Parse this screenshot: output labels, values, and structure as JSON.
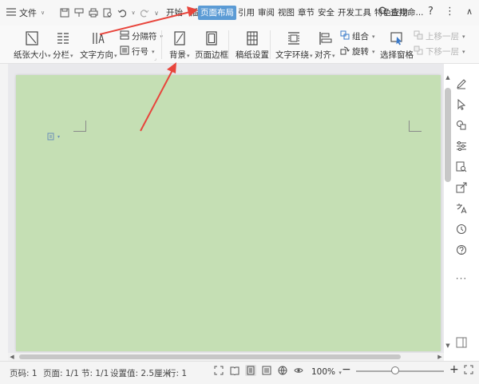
{
  "menubar": {
    "file_label": "文件",
    "tabs": [
      {
        "label": "开始",
        "active": false
      },
      {
        "label": "插入",
        "active": false
      },
      {
        "label": "页面布局",
        "active": true
      },
      {
        "label": "引用",
        "active": false
      },
      {
        "label": "审阅",
        "active": false
      },
      {
        "label": "视图",
        "active": false
      },
      {
        "label": "章节",
        "active": false
      },
      {
        "label": "安全",
        "active": false
      },
      {
        "label": "开发工具",
        "active": false
      },
      {
        "label": "特色应用",
        "active": false
      }
    ],
    "search_label": "查找命...",
    "help_label": "?"
  },
  "ribbon": {
    "paper_size": "纸张大小",
    "columns": "分栏",
    "text_direction": "文字方向",
    "separator": "分隔符",
    "line_number": "行号",
    "background": "背景",
    "page_border": "页面边框",
    "draft_settings": "稿纸设置",
    "text_wrap": "文字环绕",
    "align": "对齐",
    "group": "组合",
    "rotate": "旋转",
    "selection_pane": "选择窗格",
    "move_up": "上移一层",
    "move_down": "下移一层"
  },
  "document": {
    "page_color": "#c5dfb4"
  },
  "statusbar": {
    "page_num": "页码: 1",
    "pages": "页面: 1/1",
    "section": "节: 1/1",
    "setting": "设置值: 2.5厘米",
    "line": "行: 1",
    "zoom": "100%",
    "zoom_out": "−",
    "zoom_in": "+"
  },
  "colors": {
    "accent": "#5b9bd5",
    "annotation_arrow": "#e8453c"
  }
}
